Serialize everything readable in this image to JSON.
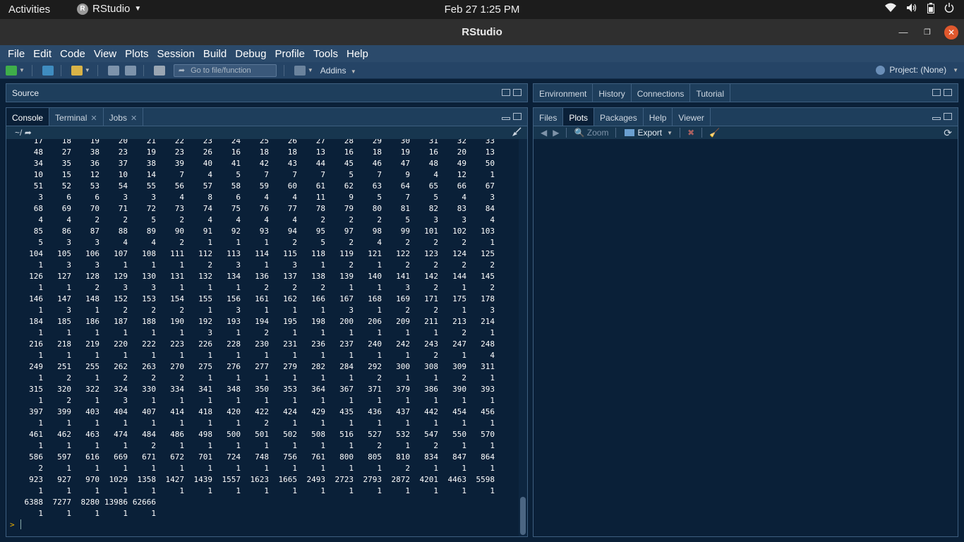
{
  "topbar": {
    "activities": "Activities",
    "app_name": "RStudio",
    "clock": "Feb 27  1:25 PM",
    "tray_icons": [
      "wifi-icon",
      "volume-icon",
      "battery-icon",
      "power-icon"
    ]
  },
  "window": {
    "title": "RStudio"
  },
  "menu": [
    "File",
    "Edit",
    "Code",
    "View",
    "Plots",
    "Session",
    "Build",
    "Debug",
    "Profile",
    "Tools",
    "Help"
  ],
  "toolbar": {
    "goto_placeholder": "Go to file/function",
    "addins": "Addins",
    "project": "Project: (None)"
  },
  "source_pane": {
    "label": "Source"
  },
  "console_pane": {
    "tabs": [
      {
        "label": "Console",
        "active": true,
        "closable": false
      },
      {
        "label": "Terminal",
        "active": false,
        "closable": true
      },
      {
        "label": "Jobs",
        "active": false,
        "closable": true
      }
    ],
    "path": "~/",
    "prompt": ">",
    "rows": [
      [
        "17",
        "18",
        "19",
        "20",
        "21",
        "22",
        "23",
        "24",
        "25",
        "26",
        "27",
        "28",
        "29",
        "30",
        "31",
        "32",
        "33"
      ],
      [
        "48",
        "27",
        "38",
        "23",
        "19",
        "23",
        "26",
        "16",
        "18",
        "18",
        "13",
        "16",
        "18",
        "19",
        "16",
        "20",
        "13"
      ],
      [
        "34",
        "35",
        "36",
        "37",
        "38",
        "39",
        "40",
        "41",
        "42",
        "43",
        "44",
        "45",
        "46",
        "47",
        "48",
        "49",
        "50"
      ],
      [
        "10",
        "15",
        "12",
        "10",
        "14",
        "7",
        "4",
        "5",
        "7",
        "7",
        "7",
        "5",
        "7",
        "9",
        "4",
        "12",
        "1"
      ],
      [
        "51",
        "52",
        "53",
        "54",
        "55",
        "56",
        "57",
        "58",
        "59",
        "60",
        "61",
        "62",
        "63",
        "64",
        "65",
        "66",
        "67"
      ],
      [
        "3",
        "6",
        "6",
        "3",
        "3",
        "4",
        "8",
        "6",
        "4",
        "4",
        "11",
        "9",
        "5",
        "7",
        "5",
        "4",
        "3"
      ],
      [
        "68",
        "69",
        "70",
        "71",
        "72",
        "73",
        "74",
        "75",
        "76",
        "77",
        "78",
        "79",
        "80",
        "81",
        "82",
        "83",
        "84"
      ],
      [
        "4",
        "4",
        "2",
        "2",
        "5",
        "2",
        "4",
        "4",
        "4",
        "4",
        "2",
        "2",
        "2",
        "5",
        "3",
        "3",
        "4"
      ],
      [
        "85",
        "86",
        "87",
        "88",
        "89",
        "90",
        "91",
        "92",
        "93",
        "94",
        "95",
        "97",
        "98",
        "99",
        "101",
        "102",
        "103"
      ],
      [
        "5",
        "3",
        "3",
        "4",
        "4",
        "2",
        "1",
        "1",
        "1",
        "2",
        "5",
        "2",
        "4",
        "2",
        "2",
        "2",
        "1"
      ],
      [
        "104",
        "105",
        "106",
        "107",
        "108",
        "111",
        "112",
        "113",
        "114",
        "115",
        "118",
        "119",
        "121",
        "122",
        "123",
        "124",
        "125"
      ],
      [
        "1",
        "3",
        "3",
        "1",
        "1",
        "1",
        "2",
        "3",
        "1",
        "3",
        "1",
        "2",
        "1",
        "2",
        "2",
        "2",
        "2"
      ],
      [
        "126",
        "127",
        "128",
        "129",
        "130",
        "131",
        "132",
        "134",
        "136",
        "137",
        "138",
        "139",
        "140",
        "141",
        "142",
        "144",
        "145"
      ],
      [
        "1",
        "1",
        "2",
        "3",
        "3",
        "1",
        "1",
        "1",
        "2",
        "2",
        "2",
        "1",
        "1",
        "3",
        "2",
        "1",
        "2"
      ],
      [
        "146",
        "147",
        "148",
        "152",
        "153",
        "154",
        "155",
        "156",
        "161",
        "162",
        "166",
        "167",
        "168",
        "169",
        "171",
        "175",
        "178"
      ],
      [
        "1",
        "3",
        "1",
        "2",
        "2",
        "2",
        "1",
        "3",
        "1",
        "1",
        "1",
        "3",
        "1",
        "2",
        "2",
        "1",
        "3"
      ],
      [
        "184",
        "185",
        "186",
        "187",
        "188",
        "190",
        "192",
        "193",
        "194",
        "195",
        "198",
        "200",
        "206",
        "209",
        "211",
        "213",
        "214"
      ],
      [
        "1",
        "1",
        "1",
        "1",
        "1",
        "1",
        "3",
        "1",
        "2",
        "1",
        "1",
        "1",
        "1",
        "1",
        "1",
        "2",
        "1"
      ],
      [
        "216",
        "218",
        "219",
        "220",
        "222",
        "223",
        "226",
        "228",
        "230",
        "231",
        "236",
        "237",
        "240",
        "242",
        "243",
        "247",
        "248"
      ],
      [
        "1",
        "1",
        "1",
        "1",
        "1",
        "1",
        "1",
        "1",
        "1",
        "1",
        "1",
        "1",
        "1",
        "1",
        "2",
        "1",
        "4"
      ],
      [
        "249",
        "251",
        "255",
        "262",
        "263",
        "270",
        "275",
        "276",
        "277",
        "279",
        "282",
        "284",
        "292",
        "300",
        "308",
        "309",
        "311"
      ],
      [
        "1",
        "2",
        "1",
        "2",
        "2",
        "2",
        "1",
        "1",
        "1",
        "1",
        "1",
        "1",
        "2",
        "1",
        "1",
        "2",
        "1"
      ],
      [
        "315",
        "320",
        "322",
        "324",
        "330",
        "334",
        "341",
        "348",
        "350",
        "353",
        "364",
        "367",
        "371",
        "379",
        "386",
        "390",
        "393"
      ],
      [
        "1",
        "2",
        "1",
        "3",
        "1",
        "1",
        "1",
        "1",
        "1",
        "1",
        "1",
        "1",
        "1",
        "1",
        "1",
        "1",
        "1"
      ],
      [
        "397",
        "399",
        "403",
        "404",
        "407",
        "414",
        "418",
        "420",
        "422",
        "424",
        "429",
        "435",
        "436",
        "437",
        "442",
        "454",
        "456"
      ],
      [
        "1",
        "1",
        "1",
        "1",
        "1",
        "1",
        "1",
        "1",
        "2",
        "1",
        "1",
        "1",
        "1",
        "1",
        "1",
        "1",
        "1"
      ],
      [
        "461",
        "462",
        "463",
        "474",
        "484",
        "486",
        "498",
        "500",
        "501",
        "502",
        "508",
        "516",
        "527",
        "532",
        "547",
        "550",
        "570"
      ],
      [
        "1",
        "1",
        "1",
        "1",
        "2",
        "1",
        "1",
        "1",
        "1",
        "1",
        "1",
        "1",
        "2",
        "1",
        "2",
        "1",
        "1"
      ],
      [
        "586",
        "597",
        "616",
        "669",
        "671",
        "672",
        "701",
        "724",
        "748",
        "756",
        "761",
        "800",
        "805",
        "810",
        "834",
        "847",
        "864"
      ],
      [
        "2",
        "1",
        "1",
        "1",
        "1",
        "1",
        "1",
        "1",
        "1",
        "1",
        "1",
        "1",
        "1",
        "2",
        "1",
        "1",
        "1"
      ],
      [
        "923",
        "927",
        "970",
        "1029",
        "1358",
        "1427",
        "1439",
        "1557",
        "1623",
        "1665",
        "2493",
        "2723",
        "2793",
        "2872",
        "4201",
        "4463",
        "5598"
      ],
      [
        "1",
        "1",
        "1",
        "1",
        "1",
        "1",
        "1",
        "1",
        "1",
        "1",
        "1",
        "1",
        "1",
        "1",
        "1",
        "1",
        "1"
      ],
      [
        "6388",
        "7277",
        "8280",
        "13986",
        "62666"
      ],
      [
        "1",
        "1",
        "1",
        "1",
        "1"
      ]
    ]
  },
  "env_pane": {
    "tabs": [
      {
        "label": "Environment",
        "active": false
      },
      {
        "label": "History",
        "active": false
      },
      {
        "label": "Connections",
        "active": false
      },
      {
        "label": "Tutorial",
        "active": false
      }
    ]
  },
  "files_pane": {
    "tabs": [
      {
        "label": "Files",
        "active": false
      },
      {
        "label": "Plots",
        "active": true
      },
      {
        "label": "Packages",
        "active": false
      },
      {
        "label": "Help",
        "active": false
      },
      {
        "label": "Viewer",
        "active": false
      }
    ],
    "zoom": "Zoom",
    "export": "Export"
  },
  "colors": {
    "background": "#0a2038",
    "menubar": "#2b4a6b",
    "prompt": "#f2b300"
  }
}
